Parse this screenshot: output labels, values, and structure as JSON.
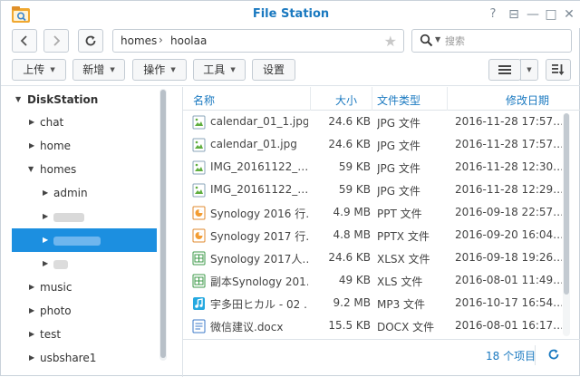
{
  "app": {
    "title": "File Station",
    "accent": "#1c8fe0",
    "link_color": "#1a79c0"
  },
  "window_controls": {
    "help": "?",
    "pin": "⊟",
    "minimize": "—",
    "maximize": "□",
    "close": "✕"
  },
  "nav": {
    "back_icon": "chevron-left-icon",
    "forward_icon": "chevron-right-icon",
    "refresh_icon": "refresh-icon",
    "path": [
      "homes",
      "hoolaa"
    ],
    "search_placeholder": "搜索"
  },
  "toolbar": {
    "upload": "上传",
    "new": "新增",
    "action": "操作",
    "tools": "工具",
    "settings": "设置"
  },
  "sidebar": {
    "root": "DiskStation",
    "items": [
      {
        "label": "chat"
      },
      {
        "label": "home"
      },
      {
        "label": "homes"
      },
      {
        "label": "admin"
      },
      {
        "label": ""
      },
      {
        "label": ""
      },
      {
        "label": ""
      },
      {
        "label": "music"
      },
      {
        "label": "photo"
      },
      {
        "label": "test"
      },
      {
        "label": "usbshare1"
      }
    ]
  },
  "grid": {
    "headers": {
      "name": "名称",
      "size": "大小",
      "type": "文件类型",
      "modified": "修改日期"
    },
    "rows": [
      {
        "name": "calendar_01_1.jpg",
        "size": "24.6 KB",
        "type": "JPG 文件",
        "modified": "2016-11-28 17:57…",
        "icon": "image-file-icon"
      },
      {
        "name": "calendar_01.jpg",
        "size": "24.6 KB",
        "type": "JPG 文件",
        "modified": "2016-11-28 17:57…",
        "icon": "image-file-icon"
      },
      {
        "name": "IMG_20161122_…",
        "size": "59 KB",
        "type": "JPG 文件",
        "modified": "2016-11-28 12:30…",
        "icon": "image-file-icon"
      },
      {
        "name": "IMG_20161122_…",
        "size": "59 KB",
        "type": "JPG 文件",
        "modified": "2016-11-28 12:29…",
        "icon": "image-file-icon"
      },
      {
        "name": "Synology 2016 行…",
        "size": "4.9 MB",
        "type": "PPT 文件",
        "modified": "2016-09-18 22:57…",
        "icon": "ppt-file-icon"
      },
      {
        "name": "Synology 2017 行…",
        "size": "4.8 MB",
        "type": "PPTX 文件",
        "modified": "2016-09-20 16:04…",
        "icon": "ppt-file-icon"
      },
      {
        "name": "Synology 2017人…",
        "size": "24.6 KB",
        "type": "XLSX 文件",
        "modified": "2016-09-18 19:26…",
        "icon": "spreadsheet-file-icon"
      },
      {
        "name": "副本Synology 201…",
        "size": "49 KB",
        "type": "XLS 文件",
        "modified": "2016-08-01 11:49…",
        "icon": "spreadsheet-file-icon"
      },
      {
        "name": "宇多田ヒカル - 02 …",
        "size": "9.2 MB",
        "type": "MP3 文件",
        "modified": "2016-10-17 16:54…",
        "icon": "audio-file-icon"
      },
      {
        "name": "微信建议.docx",
        "size": "15.5 KB",
        "type": "DOCX 文件",
        "modified": "2016-08-01 16:17…",
        "icon": "document-file-icon"
      }
    ]
  },
  "footer": {
    "count": "18 个项目"
  }
}
